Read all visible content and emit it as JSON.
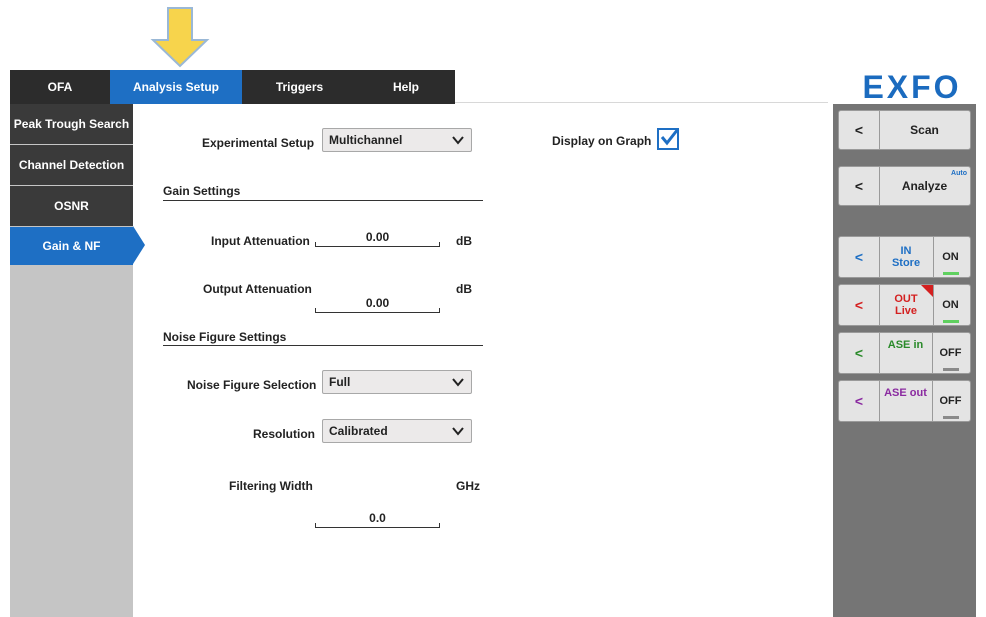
{
  "nav": {
    "tabs": [
      {
        "label": "OFA",
        "active": false
      },
      {
        "label": "Analysis Setup",
        "active": true
      },
      {
        "label": "Triggers",
        "active": false
      },
      {
        "label": "Help",
        "active": false
      }
    ],
    "logo": "EXFO"
  },
  "sidebar": {
    "items": [
      {
        "label": "Peak Trough Search",
        "active": false
      },
      {
        "label": "Channel Detection",
        "active": false
      },
      {
        "label": "OSNR",
        "active": false
      },
      {
        "label": "Gain & NF",
        "active": true
      }
    ]
  },
  "main": {
    "experimental_setup": {
      "label": "Experimental Setup",
      "value": "Multichannel"
    },
    "display_on_graph": {
      "label": "Display on Graph",
      "checked": true
    },
    "gain_settings": {
      "title": "Gain Settings",
      "input_attenuation": {
        "label": "Input Attenuation",
        "value": "0.00",
        "unit": "dB"
      },
      "output_attenuation": {
        "label": "Output Attenuation",
        "value": "0.00",
        "unit": "dB"
      }
    },
    "noise_figure_settings": {
      "title": "Noise Figure Settings",
      "selection": {
        "label": "Noise Figure Selection",
        "value": "Full"
      },
      "resolution": {
        "label": "Resolution",
        "value": "Calibrated"
      },
      "filtering_width": {
        "label": "Filtering Width",
        "value": "0.0",
        "unit": "GHz"
      }
    }
  },
  "right_panel": {
    "scan": {
      "label": "Scan",
      "chevron": "<"
    },
    "analyze": {
      "label": "Analyze",
      "tag": "Auto",
      "chevron": "<"
    },
    "traces": [
      {
        "line1": "IN",
        "line2": "Store",
        "state": "ON",
        "color": "#1e6fc4",
        "led": "#5fd05f"
      },
      {
        "line1": "OUT",
        "line2": "Live",
        "state": "ON",
        "color": "#d42020",
        "led": "#5fd05f"
      },
      {
        "line1": "ASE in",
        "line2": "",
        "state": "OFF",
        "color": "#2a8a2a",
        "led": "#8a8a8a"
      },
      {
        "line1": "ASE out",
        "line2": "",
        "state": "OFF",
        "color": "#8a2aa0",
        "led": "#8a8a8a"
      }
    ]
  },
  "colors": {
    "accent": "#1e6fc4",
    "arrow": "#f7d44c"
  }
}
